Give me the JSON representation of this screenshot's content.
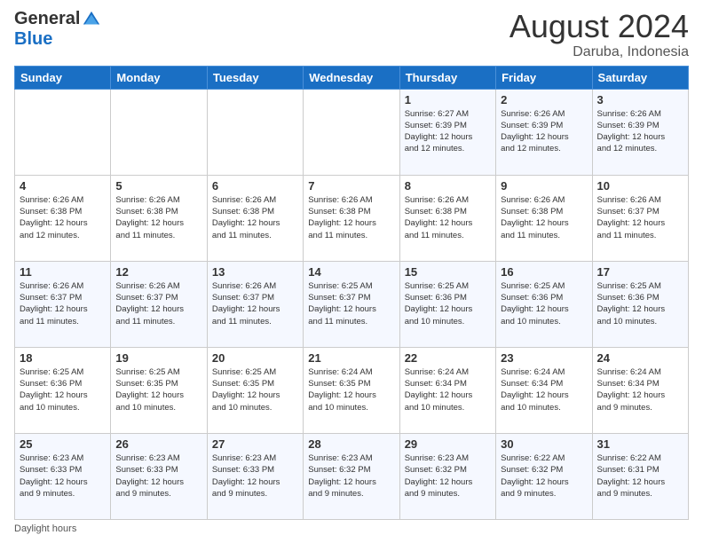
{
  "logo": {
    "general": "General",
    "blue": "Blue"
  },
  "header": {
    "month_year": "August 2024",
    "location": "Daruba, Indonesia"
  },
  "days_of_week": [
    "Sunday",
    "Monday",
    "Tuesday",
    "Wednesday",
    "Thursday",
    "Friday",
    "Saturday"
  ],
  "weeks": [
    [
      {
        "day": "",
        "info": ""
      },
      {
        "day": "",
        "info": ""
      },
      {
        "day": "",
        "info": ""
      },
      {
        "day": "",
        "info": ""
      },
      {
        "day": "1",
        "info": "Sunrise: 6:27 AM\nSunset: 6:39 PM\nDaylight: 12 hours\nand 12 minutes."
      },
      {
        "day": "2",
        "info": "Sunrise: 6:26 AM\nSunset: 6:39 PM\nDaylight: 12 hours\nand 12 minutes."
      },
      {
        "day": "3",
        "info": "Sunrise: 6:26 AM\nSunset: 6:39 PM\nDaylight: 12 hours\nand 12 minutes."
      }
    ],
    [
      {
        "day": "4",
        "info": "Sunrise: 6:26 AM\nSunset: 6:38 PM\nDaylight: 12 hours\nand 12 minutes."
      },
      {
        "day": "5",
        "info": "Sunrise: 6:26 AM\nSunset: 6:38 PM\nDaylight: 12 hours\nand 11 minutes."
      },
      {
        "day": "6",
        "info": "Sunrise: 6:26 AM\nSunset: 6:38 PM\nDaylight: 12 hours\nand 11 minutes."
      },
      {
        "day": "7",
        "info": "Sunrise: 6:26 AM\nSunset: 6:38 PM\nDaylight: 12 hours\nand 11 minutes."
      },
      {
        "day": "8",
        "info": "Sunrise: 6:26 AM\nSunset: 6:38 PM\nDaylight: 12 hours\nand 11 minutes."
      },
      {
        "day": "9",
        "info": "Sunrise: 6:26 AM\nSunset: 6:38 PM\nDaylight: 12 hours\nand 11 minutes."
      },
      {
        "day": "10",
        "info": "Sunrise: 6:26 AM\nSunset: 6:37 PM\nDaylight: 12 hours\nand 11 minutes."
      }
    ],
    [
      {
        "day": "11",
        "info": "Sunrise: 6:26 AM\nSunset: 6:37 PM\nDaylight: 12 hours\nand 11 minutes."
      },
      {
        "day": "12",
        "info": "Sunrise: 6:26 AM\nSunset: 6:37 PM\nDaylight: 12 hours\nand 11 minutes."
      },
      {
        "day": "13",
        "info": "Sunrise: 6:26 AM\nSunset: 6:37 PM\nDaylight: 12 hours\nand 11 minutes."
      },
      {
        "day": "14",
        "info": "Sunrise: 6:25 AM\nSunset: 6:37 PM\nDaylight: 12 hours\nand 11 minutes."
      },
      {
        "day": "15",
        "info": "Sunrise: 6:25 AM\nSunset: 6:36 PM\nDaylight: 12 hours\nand 10 minutes."
      },
      {
        "day": "16",
        "info": "Sunrise: 6:25 AM\nSunset: 6:36 PM\nDaylight: 12 hours\nand 10 minutes."
      },
      {
        "day": "17",
        "info": "Sunrise: 6:25 AM\nSunset: 6:36 PM\nDaylight: 12 hours\nand 10 minutes."
      }
    ],
    [
      {
        "day": "18",
        "info": "Sunrise: 6:25 AM\nSunset: 6:36 PM\nDaylight: 12 hours\nand 10 minutes."
      },
      {
        "day": "19",
        "info": "Sunrise: 6:25 AM\nSunset: 6:35 PM\nDaylight: 12 hours\nand 10 minutes."
      },
      {
        "day": "20",
        "info": "Sunrise: 6:25 AM\nSunset: 6:35 PM\nDaylight: 12 hours\nand 10 minutes."
      },
      {
        "day": "21",
        "info": "Sunrise: 6:24 AM\nSunset: 6:35 PM\nDaylight: 12 hours\nand 10 minutes."
      },
      {
        "day": "22",
        "info": "Sunrise: 6:24 AM\nSunset: 6:34 PM\nDaylight: 12 hours\nand 10 minutes."
      },
      {
        "day": "23",
        "info": "Sunrise: 6:24 AM\nSunset: 6:34 PM\nDaylight: 12 hours\nand 10 minutes."
      },
      {
        "day": "24",
        "info": "Sunrise: 6:24 AM\nSunset: 6:34 PM\nDaylight: 12 hours\nand 9 minutes."
      }
    ],
    [
      {
        "day": "25",
        "info": "Sunrise: 6:23 AM\nSunset: 6:33 PM\nDaylight: 12 hours\nand 9 minutes."
      },
      {
        "day": "26",
        "info": "Sunrise: 6:23 AM\nSunset: 6:33 PM\nDaylight: 12 hours\nand 9 minutes."
      },
      {
        "day": "27",
        "info": "Sunrise: 6:23 AM\nSunset: 6:33 PM\nDaylight: 12 hours\nand 9 minutes."
      },
      {
        "day": "28",
        "info": "Sunrise: 6:23 AM\nSunset: 6:32 PM\nDaylight: 12 hours\nand 9 minutes."
      },
      {
        "day": "29",
        "info": "Sunrise: 6:23 AM\nSunset: 6:32 PM\nDaylight: 12 hours\nand 9 minutes."
      },
      {
        "day": "30",
        "info": "Sunrise: 6:22 AM\nSunset: 6:32 PM\nDaylight: 12 hours\nand 9 minutes."
      },
      {
        "day": "31",
        "info": "Sunrise: 6:22 AM\nSunset: 6:31 PM\nDaylight: 12 hours\nand 9 minutes."
      }
    ]
  ],
  "footer": {
    "note": "Daylight hours"
  }
}
